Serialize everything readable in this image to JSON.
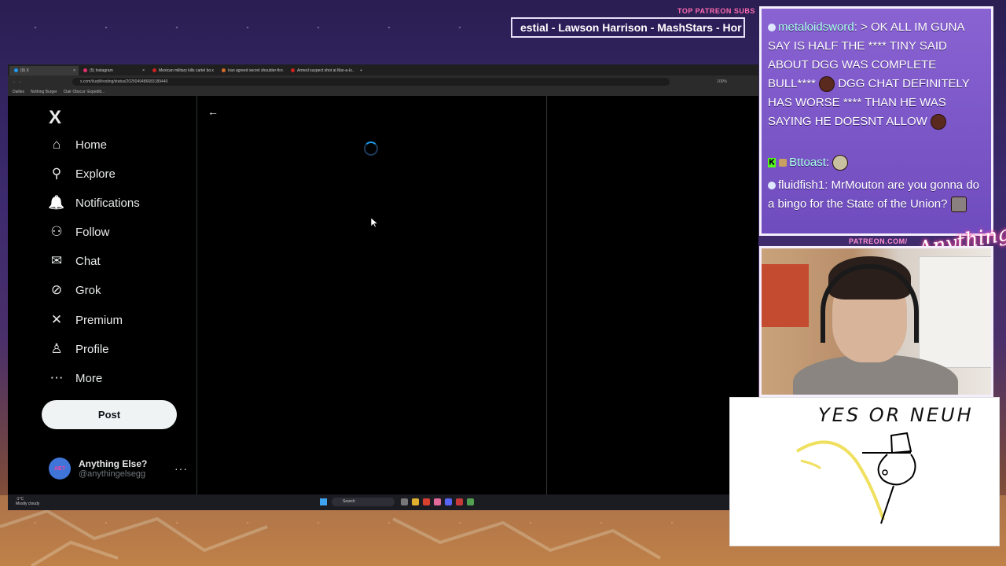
{
  "patreon": {
    "label": "TOP PATREON SUBS",
    "ticker": "estial - Lawson Harrison - MashStars - Hor"
  },
  "browser": {
    "tabs": [
      {
        "label": "(9) X",
        "color": "#1d9bf0",
        "active": true
      },
      {
        "label": "(5) Instagram",
        "color": "#e1306c"
      },
      {
        "label": "Mexican military kills cartel bo...",
        "color": "#cc2222"
      },
      {
        "label": "Iran agreed secret shoulder-fir...",
        "color": "#d66a2a"
      },
      {
        "label": "Armed suspect shot at Mar-a-L...",
        "color": "#cc2222"
      }
    ],
    "url": "x.com/i/uqWresting/status/2025049486683189440",
    "zoom": "100%",
    "bookmarks": [
      "Dailies",
      "Nothing Burger",
      "Clair Obscur: Expediti..."
    ]
  },
  "xnav": {
    "logo": "X",
    "items": [
      {
        "label": "Home",
        "icon": "home-icon",
        "glyph": "⌂"
      },
      {
        "label": "Explore",
        "icon": "search-icon",
        "glyph": "⚲"
      },
      {
        "label": "Notifications",
        "icon": "bell-icon",
        "glyph": "🔔"
      },
      {
        "label": "Follow",
        "icon": "follow-icon",
        "glyph": "⚇"
      },
      {
        "label": "Chat",
        "icon": "mail-icon",
        "glyph": "✉"
      },
      {
        "label": "Grok",
        "icon": "grok-icon",
        "glyph": "⊘"
      },
      {
        "label": "Premium",
        "icon": "x-premium-icon",
        "glyph": "✕"
      },
      {
        "label": "Profile",
        "icon": "profile-icon",
        "glyph": "♙"
      },
      {
        "label": "More",
        "icon": "more-icon",
        "glyph": "⋯"
      }
    ],
    "post_label": "Post",
    "account": {
      "name": "Anything Else?",
      "handle": "@anythingelsegg",
      "avatar_text": "AE?"
    },
    "more_dots": "···"
  },
  "main": {
    "back_glyph": "←"
  },
  "taskbar": {
    "weather_temp": "-1°C",
    "weather_desc": "Mostly cloudy",
    "search": "Search"
  },
  "chat": [
    {
      "user": "metaloidsword",
      "text": "> OK ALL IM GUNA SAY IS HALF THE **** TINY SAID ABOUT DGG WAS COMPLETE BULL**** ",
      "mid": " DGG CHAT DEFINITELY HAS WORSE **** THAN HE WAS SAYING HE DOESNT ALLOW "
    },
    {
      "user": "Bttoast",
      "text": ""
    },
    {
      "user": "fluidfish1",
      "text": "MrMouton are you gonna do a bingo for the State of the Union?"
    }
  ],
  "cam": {
    "patreon_url": "PATREON.COM/",
    "brand": "Anything Else?"
  },
  "drawing": {
    "title": "YES OR NEUH"
  }
}
